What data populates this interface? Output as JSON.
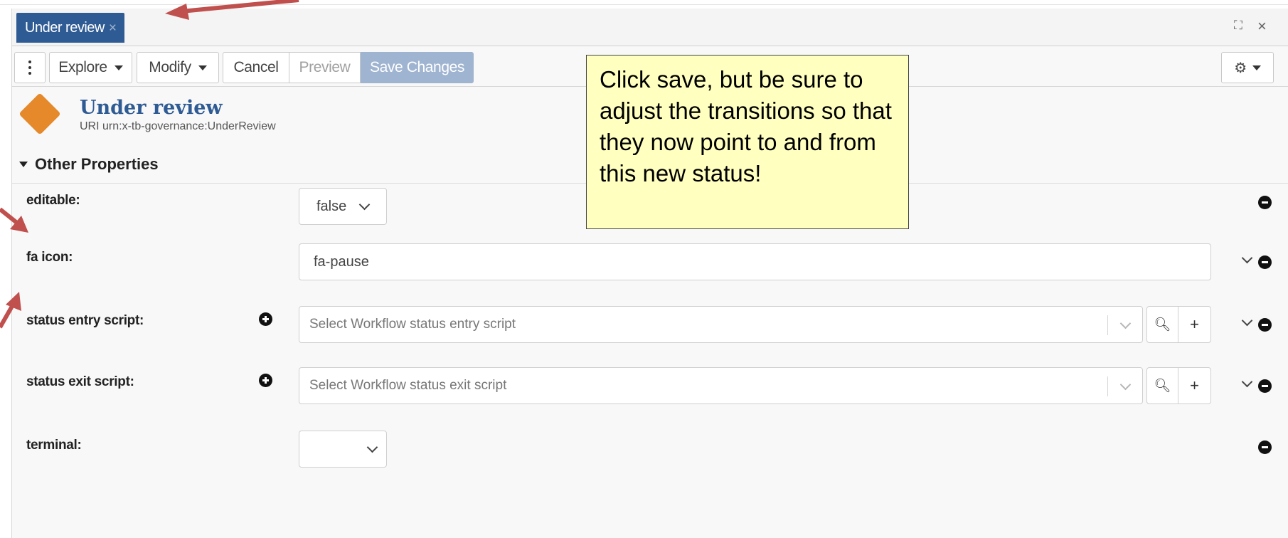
{
  "tab": {
    "label": "Under review"
  },
  "toolbar": {
    "explore_label": "Explore",
    "modify_label": "Modify",
    "cancel_label": "Cancel",
    "preview_label": "Preview",
    "save_label": "Save Changes"
  },
  "header": {
    "title": "Under review",
    "uri": "URI urn:x-tb-governance:UnderReview"
  },
  "section": {
    "title": "Other Properties"
  },
  "properties": [
    {
      "label": "editable:",
      "value": "false"
    },
    {
      "label": "fa icon:",
      "value": "fa-pause"
    },
    {
      "label": "status entry script:",
      "placeholder": "Select Workflow status entry script"
    },
    {
      "label": "status exit script:",
      "placeholder": "Select Workflow status exit script"
    },
    {
      "label": "terminal:",
      "value": ""
    }
  ],
  "callout": {
    "text": "Click save, but be sure to adjust the transitions so that they now point to and from this new status!"
  },
  "colors": {
    "accent": "#2f5b94",
    "icon": "#e5892a",
    "callout_bg": "#ffffc0",
    "arrow": "#c0504d"
  }
}
